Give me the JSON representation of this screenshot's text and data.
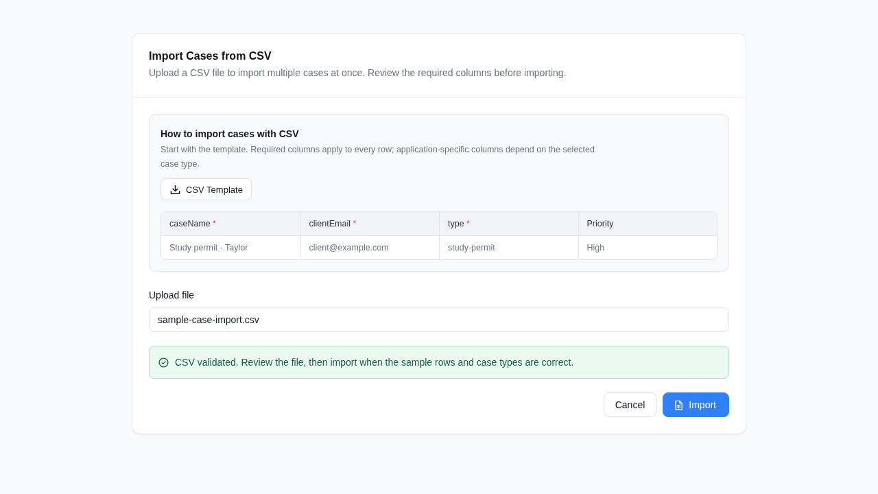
{
  "dialog": {
    "title": "Import Cases from CSV",
    "description": "Upload a CSV file to import multiple cases at once. Review the required columns before importing."
  },
  "guide": {
    "title": "How to import cases with CSV",
    "description": "Start with the template. Required columns apply to every row; application-specific columns depend on the selected case type.",
    "template_button": "CSV Template",
    "table": {
      "columns": [
        {
          "label": "caseName",
          "required_mark": "*"
        },
        {
          "label": "clientEmail",
          "required_mark": "*"
        },
        {
          "label": "type",
          "required_mark": "*"
        },
        {
          "label": "Priority"
        }
      ],
      "rows": [
        [
          "Study permit - Taylor",
          "client@example.com",
          "study-permit",
          "High"
        ]
      ]
    }
  },
  "upload": {
    "label": "Upload file",
    "value": "sample-case-import.csv"
  },
  "alert": {
    "kind": "success",
    "message": "CSV validated. Review the file, then import when the sample rows and case types are correct."
  },
  "buttons": [
    {
      "label": "Cancel",
      "kind": "secondary"
    },
    {
      "label": "Import",
      "kind": "primary"
    }
  ]
}
